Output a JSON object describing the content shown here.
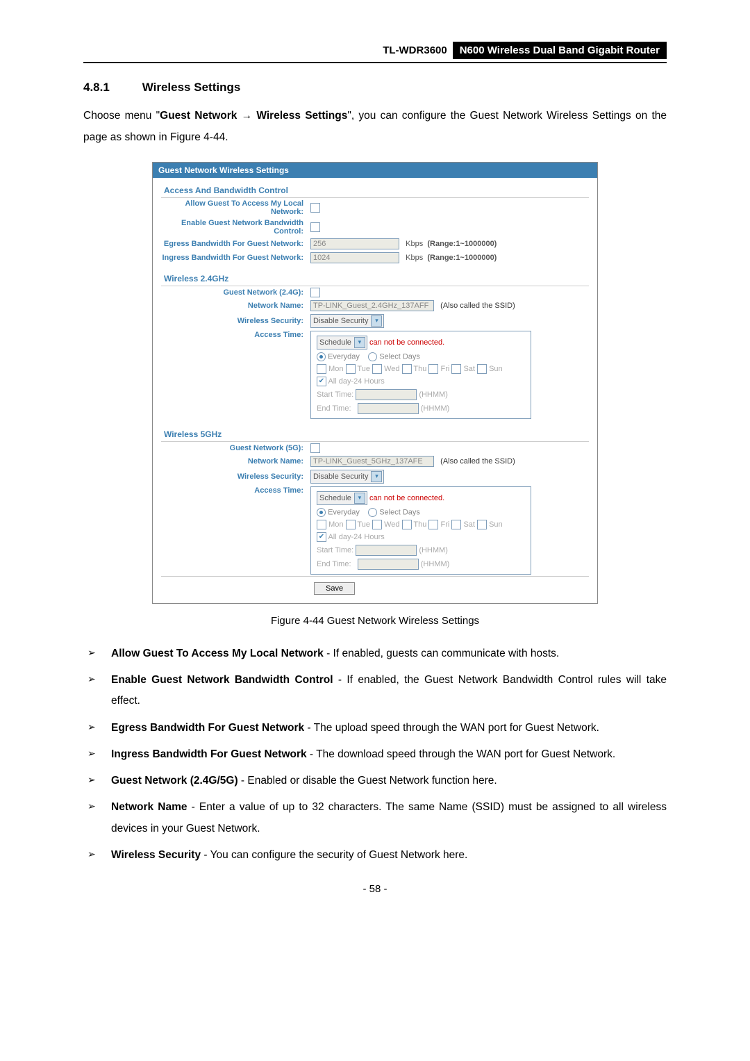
{
  "header": {
    "model": "TL-WDR3600",
    "product": "N600 Wireless Dual Band Gigabit Router"
  },
  "section": {
    "num": "4.8.1",
    "title": "Wireless Settings",
    "intro1": "Choose menu \"",
    "intro2": "Guest Network",
    "introArrow": "→",
    "intro3": "Wireless Settings",
    "intro4": "\", you can configure the Guest Network Wireless Settings on the page as shown in Figure 4-44."
  },
  "panel": {
    "title": "Guest Network Wireless Settings",
    "sec1": {
      "hdr": "Access And Bandwidth Control",
      "row1": "Allow Guest To Access My Local Network:",
      "row2": "Enable Guest Network Bandwidth Control:",
      "row3": "Egress Bandwidth For Guest Network:",
      "row3val": "256",
      "rangeK": "Kbps",
      "rangeLbl": "(Range:1~1000000)",
      "row4": "Ingress Bandwidth For Guest Network:",
      "row4val": "1024"
    },
    "sec2": {
      "hdr": "Wireless 2.4GHz",
      "label1": "Guest Network (2.4G):",
      "labelName": "Network Name:",
      "nameVal": "TP-LINK_Guest_2.4GHz_137AFF",
      "ssidNote": "(Also called the SSID)",
      "labelSec": "Wireless Security:",
      "secVal": "Disable Security",
      "labelTime": "Access Time:",
      "scheduleVal": "Schedule",
      "noConn": "can not be connected.",
      "everyday": "Everyday",
      "selDays": "Select Days",
      "mon": "Mon",
      "tue": "Tue",
      "wed": "Wed",
      "thu": "Thu",
      "fri": "Fri",
      "sat": "Sat",
      "sun": "Sun",
      "allDay": "All day-24 Hours",
      "start": "Start Time:",
      "end": "End Time:",
      "hhmm": "(HHMM)"
    },
    "sec3": {
      "hdr": "Wireless 5GHz",
      "label1": "Guest Network (5G):",
      "nameVal": "TP-LINK_Guest_5GHz_137AFE"
    },
    "save": "Save"
  },
  "figCaption": "Figure 4-44 Guest Network Wireless Settings",
  "bullets": [
    {
      "b": "Allow Guest To Access My Local Network",
      "t": " - If enabled, guests can communicate with hosts."
    },
    {
      "b": "Enable Guest Network Bandwidth Control",
      "t": " - If enabled, the Guest Network Bandwidth Control rules will take effect."
    },
    {
      "b": "Egress Bandwidth For Guest Network",
      "t": " - The upload speed through the WAN port for Guest Network."
    },
    {
      "b": "Ingress Bandwidth For Guest Network",
      "t": " - The download speed through the WAN port for Guest Network."
    },
    {
      "b": "Guest Network (2.4G/5G)",
      "t": " - Enabled or disable the Guest Network function here."
    },
    {
      "b": "Network Name",
      "t": " - Enter a value of up to 32 characters. The same Name (SSID) must be assigned to all wireless devices in your Guest Network."
    },
    {
      "b": "Wireless Security",
      "t": " - You can configure the security of Guest Network here."
    }
  ],
  "pageNum": "- 58 -"
}
